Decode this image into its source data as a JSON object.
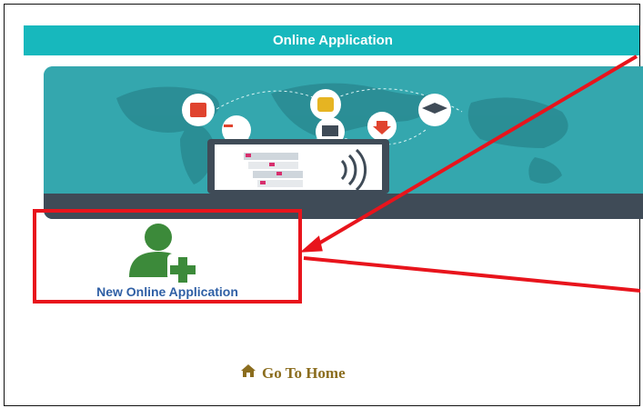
{
  "header": {
    "title": "Online Application"
  },
  "tile": {
    "label": "New Online Application",
    "icon": "add-user-icon"
  },
  "footer": {
    "home_label": "Go To Home",
    "home_icon": "home-icon"
  },
  "colors": {
    "header_bg": "#17b8bd",
    "highlight": "#e8141c",
    "user_icon": "#3c8a3a",
    "label": "#2f5fa5",
    "home": "#8b6d1e",
    "banner_bg": "#34a7ae"
  }
}
